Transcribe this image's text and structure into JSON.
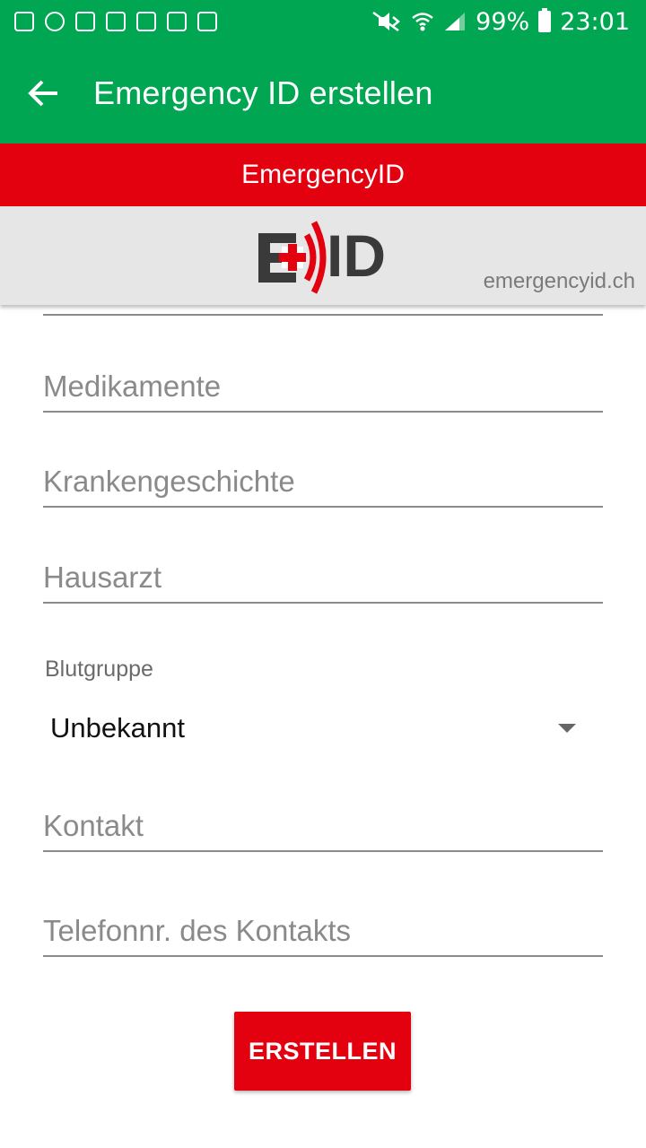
{
  "status_bar": {
    "battery": "99%",
    "time": "23:01",
    "icons": [
      "image-icon",
      "sync-icon",
      "gmail-icon",
      "email-icon",
      "galaxy-icon",
      "galaxy-icon",
      "clipboard-check-icon",
      "mute-icon",
      "wifi-icon",
      "signal-icon",
      "battery-icon"
    ]
  },
  "app_bar": {
    "title": "Emergency ID erstellen",
    "back_icon": "arrow-left-icon"
  },
  "banner": {
    "text": "EmergencyID"
  },
  "logo": {
    "text": "ID",
    "site": "emergencyid.ch",
    "colors": {
      "red": "#e3000f",
      "dark": "#3a3a3a"
    }
  },
  "form": {
    "fields": [
      {
        "label": "Medikamente"
      },
      {
        "label": "Krankengeschichte"
      },
      {
        "label": "Hausarzt"
      }
    ],
    "blood_group": {
      "label": "Blutgruppe",
      "value": "Unbekannt"
    },
    "contact_fields": [
      {
        "label": "Kontakt"
      },
      {
        "label": "Telefonnr. des Kontakts"
      }
    ],
    "submit_label": "ERSTELLEN"
  },
  "colors": {
    "green": "#00a651",
    "red": "#e3000f",
    "logo_bg": "#e6e6e6"
  }
}
